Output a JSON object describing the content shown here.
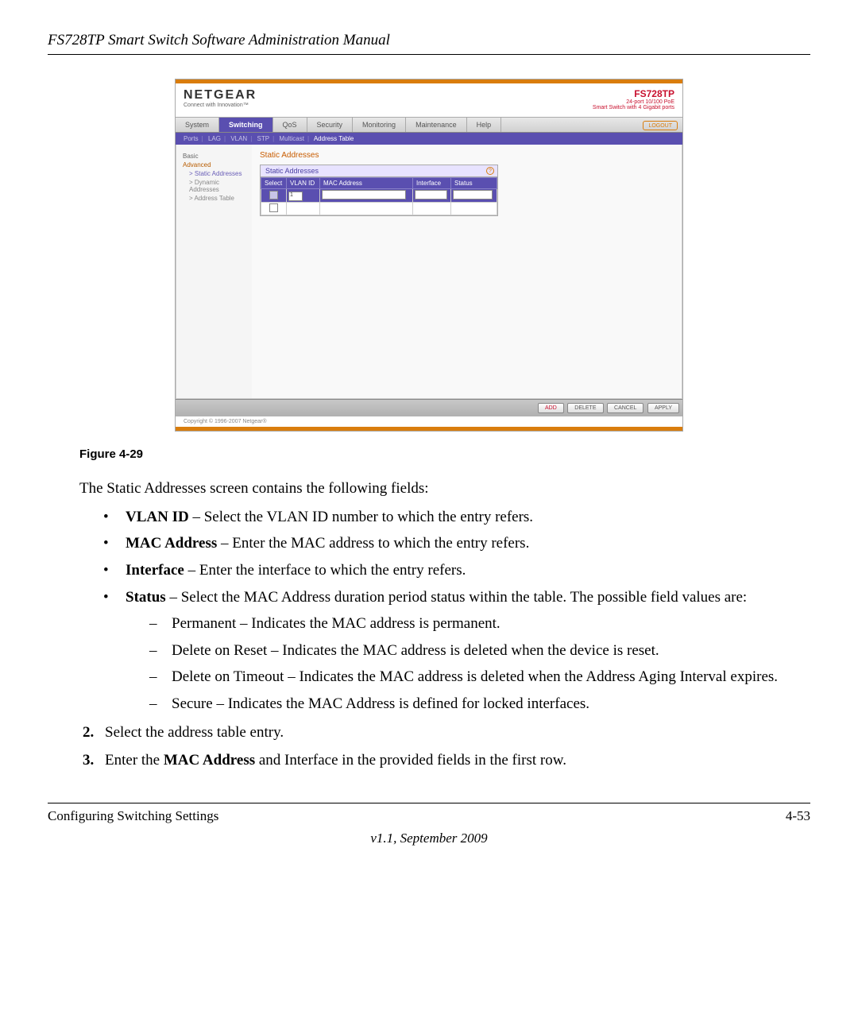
{
  "doc": {
    "header": "FS728TP Smart Switch Software Administration Manual",
    "figure_caption": "Figure 4-29",
    "intro": "The Static Addresses screen contains the following fields:",
    "bullets": [
      {
        "term": "VLAN ID",
        "desc": " – Select the VLAN ID number to which the entry refers."
      },
      {
        "term": "MAC Address",
        "desc": " – Enter the MAC address to which the entry refers."
      },
      {
        "term": "Interface",
        "desc": " – Enter the interface to which the entry refers."
      },
      {
        "term": "Status",
        "desc": " – Select the MAC Address duration period status within the table. The possible field values are:"
      }
    ],
    "sub": [
      "Permanent – Indicates the MAC address is permanent.",
      "Delete on Reset – Indicates the MAC address is deleted when the device is reset.",
      "Delete on Timeout – Indicates the MAC address is deleted when the Address Aging Interval expires.",
      "Secure – Indicates the MAC Address is defined for locked interfaces."
    ],
    "step2": "Select the address table entry.",
    "step3_pre": "Enter the ",
    "step3_bold": "MAC Address",
    "step3_post": " and Interface in the provided fields in the first row.",
    "footer_left": "Configuring Switching Settings",
    "footer_right": "4-53",
    "version": "v1.1, September 2009"
  },
  "ss": {
    "brand": "NETGEAR",
    "brand_tag": "Connect with Innovation™",
    "product": "FS728TP",
    "product_sub1": "24-port 10/100 PoE",
    "product_sub2": "Smart Switch with 4 Gigabit ports",
    "tabs": [
      "System",
      "Switching",
      "QoS",
      "Security",
      "Monitoring",
      "Maintenance",
      "Help"
    ],
    "logout": "LOGOUT",
    "subnav": [
      "Ports",
      "LAG",
      "VLAN",
      "STP",
      "Multicast",
      "Address Table"
    ],
    "sidebar": {
      "cat1": "Basic",
      "cat2": "Advanced",
      "items": [
        "> Static Addresses",
        "> Dynamic Addresses",
        "> Address Table"
      ]
    },
    "panel_title": "Static Addresses",
    "panel_head": "Static Addresses",
    "columns": [
      "Select",
      "VLAN ID",
      "MAC Address",
      "Interface",
      "Status"
    ],
    "vlan_value": "1",
    "buttons": {
      "add": "ADD",
      "delete": "DELETE",
      "cancel": "CANCEL",
      "apply": "APPLY"
    },
    "copyright": "Copyright © 1996-2007 Netgear®"
  }
}
